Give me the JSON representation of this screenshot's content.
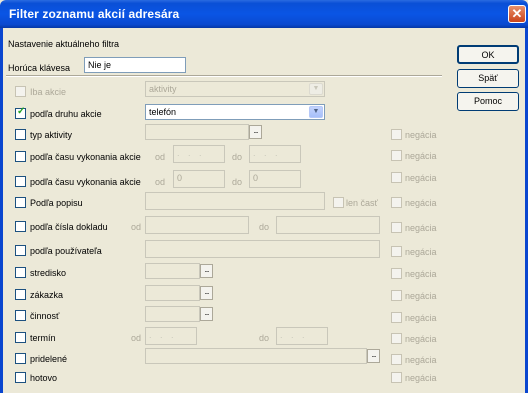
{
  "window": {
    "title": "Filter zoznamu akcií adresára",
    "close_glyph": "✕"
  },
  "header": {
    "section_label": "Nastavenie aktuálneho filtra",
    "hotkey_label": "Horúca klávesa",
    "hotkey_value": "Nie je"
  },
  "buttons": {
    "ok": "OK",
    "back": "Späť",
    "help": "Pomoc"
  },
  "rows": {
    "iba_akcie": {
      "label": "Iba akcie",
      "value": "aktivity"
    },
    "druh_akcie": {
      "label": "podľa druhu akcie",
      "value": "telefón",
      "checked": true
    },
    "typ_aktivity": {
      "label": "typ aktivity",
      "neg": "negácia"
    },
    "cas1": {
      "label": "podľa času vykonania akcie",
      "od": "od",
      "do": "do",
      "placeholder": ". . .",
      "neg": "negácia"
    },
    "cas2": {
      "label": "podľa času vykonania akcie",
      "od": "od",
      "do": "do",
      "od_value": "0",
      "do_value": "0",
      "neg": "negácia"
    },
    "popis": {
      "label": "Podľa popisu",
      "len_cast": "len časť",
      "neg": "negácia"
    },
    "doklad": {
      "label": "podľa čísla dokladu",
      "od": "od",
      "do": "do",
      "neg": "negácia"
    },
    "pouzivatel": {
      "label": "podľa používateľa",
      "neg": "negácia"
    },
    "stredisko": {
      "label": "stredisko",
      "neg": "negácia"
    },
    "zakazka": {
      "label": "zákazka",
      "neg": "negácia"
    },
    "cinnost": {
      "label": "činnosť",
      "neg": "negácia"
    },
    "termin": {
      "label": "termín",
      "od": "od",
      "do": "do",
      "placeholder": ". . .",
      "neg": "negácia"
    },
    "pridelene": {
      "label": "pridelené",
      "neg": "negácia"
    },
    "hotovo": {
      "label": "hotovo",
      "neg": "negácia"
    }
  },
  "glyphs": {
    "check": "✓",
    "dropdown": "▼",
    "browse": "..."
  }
}
